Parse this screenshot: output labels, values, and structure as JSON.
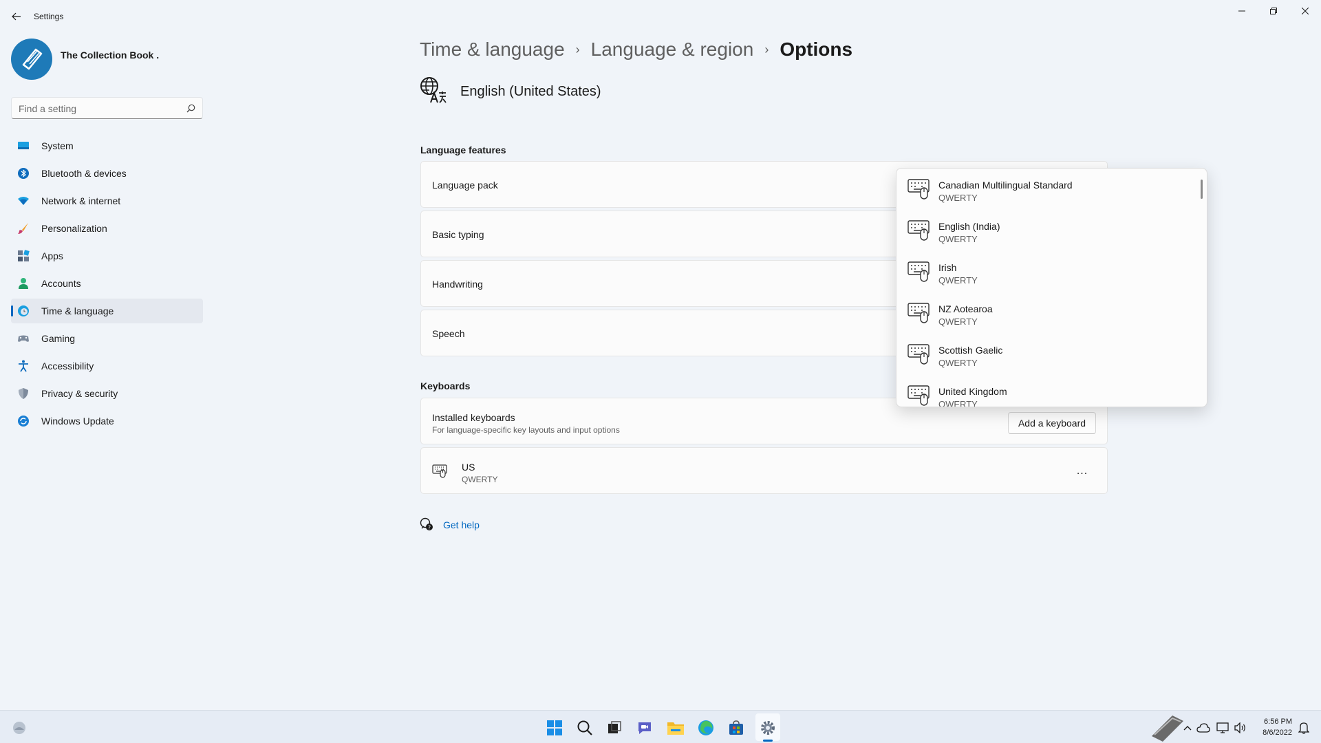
{
  "window": {
    "title": "Settings",
    "back_icon": "back-arrow-icon",
    "minimize_icon": "minimize-icon",
    "restore_icon": "restore-icon",
    "close_icon": "close-icon"
  },
  "profile": {
    "name": "The Collection Book .",
    "avatar_icon": "book-logo-icon"
  },
  "search": {
    "placeholder": "Find a setting",
    "value": ""
  },
  "nav": {
    "items": [
      {
        "label": "System",
        "icon": "system-icon",
        "selected": false
      },
      {
        "label": "Bluetooth & devices",
        "icon": "bluetooth-icon",
        "selected": false
      },
      {
        "label": "Network & internet",
        "icon": "wifi-icon",
        "selected": false
      },
      {
        "label": "Personalization",
        "icon": "brush-icon",
        "selected": false
      },
      {
        "label": "Apps",
        "icon": "apps-icon",
        "selected": false
      },
      {
        "label": "Accounts",
        "icon": "accounts-icon",
        "selected": false
      },
      {
        "label": "Time & language",
        "icon": "time-language-icon",
        "selected": true
      },
      {
        "label": "Gaming",
        "icon": "gaming-icon",
        "selected": false
      },
      {
        "label": "Accessibility",
        "icon": "accessibility-icon",
        "selected": false
      },
      {
        "label": "Privacy & security",
        "icon": "shield-icon",
        "selected": false
      },
      {
        "label": "Windows Update",
        "icon": "update-icon",
        "selected": false
      }
    ]
  },
  "breadcrumb": {
    "items": [
      "Time & language",
      "Language & region"
    ],
    "current": "Options"
  },
  "language": {
    "title": "English (United States)",
    "icon": "language-icon"
  },
  "features": {
    "title": "Language features",
    "items": [
      "Language pack",
      "Basic typing",
      "Handwriting",
      "Speech"
    ]
  },
  "keyboards": {
    "title": "Keyboards",
    "installed_label": "Installed keyboards",
    "installed_sub": "For language-specific key layouts and input options",
    "add_button": "Add a keyboard",
    "installed": [
      {
        "name": "US",
        "layout": "QWERTY"
      }
    ],
    "more_label": "..."
  },
  "help": {
    "label": "Get help",
    "icon": "help-icon"
  },
  "flyout": {
    "items": [
      {
        "name": "Canadian Multilingual Standard",
        "layout": "QWERTY"
      },
      {
        "name": "English (India)",
        "layout": "QWERTY"
      },
      {
        "name": "Irish",
        "layout": "QWERTY"
      },
      {
        "name": "NZ Aotearoa",
        "layout": "QWERTY"
      },
      {
        "name": "Scottish Gaelic",
        "layout": "QWERTY"
      },
      {
        "name": "United Kingdom",
        "layout": "QWERTY"
      }
    ]
  },
  "taskbar": {
    "apps": [
      "start-icon",
      "search-icon",
      "task-view-icon",
      "chat-icon",
      "file-explorer-icon",
      "edge-icon",
      "store-icon",
      "settings-icon"
    ],
    "time": "6:56 PM",
    "date": "8/6/2022"
  },
  "colors": {
    "accent": "#0067c0",
    "background": "#f0f4f9",
    "card": "#fbfbfb"
  }
}
